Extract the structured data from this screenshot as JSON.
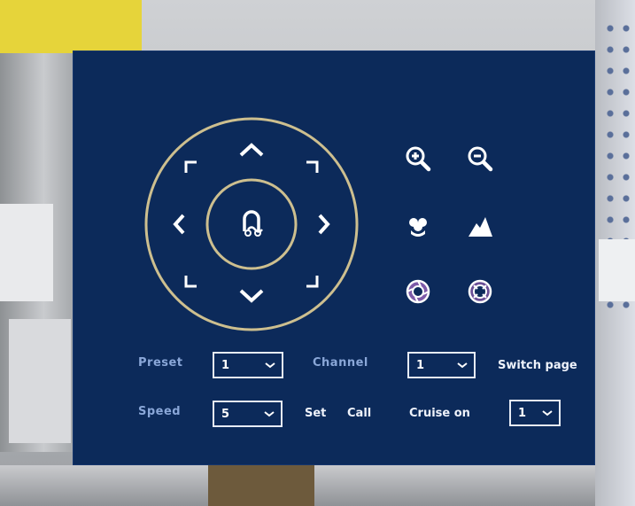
{
  "ptz_panel": {
    "controls": {
      "up": "chevron-up-icon",
      "down": "chevron-down-icon",
      "left": "chevron-left-icon",
      "right": "chevron-right-icon",
      "center": "ptz-center-icon",
      "zoom_in": "zoom-in-icon",
      "zoom_out": "zoom-out-icon",
      "focus_near": "focus-near-icon",
      "focus_far": "focus-far-icon",
      "iris_open": "iris-open-icon",
      "iris_close": "iris-close-icon"
    },
    "colors": {
      "panel": "#0c2a5a",
      "ring": "#cdbf8f",
      "label": "#8aa7d8",
      "text": "#ffffff"
    },
    "preset": {
      "label": "Preset",
      "value": "1"
    },
    "channel": {
      "label": "Channel",
      "value": "1"
    },
    "switch_page": "Switch page",
    "speed": {
      "label": "Speed",
      "value": "5"
    },
    "set": "Set",
    "call": "Call",
    "cruise": {
      "label": "Cruise on",
      "value": "1"
    }
  }
}
